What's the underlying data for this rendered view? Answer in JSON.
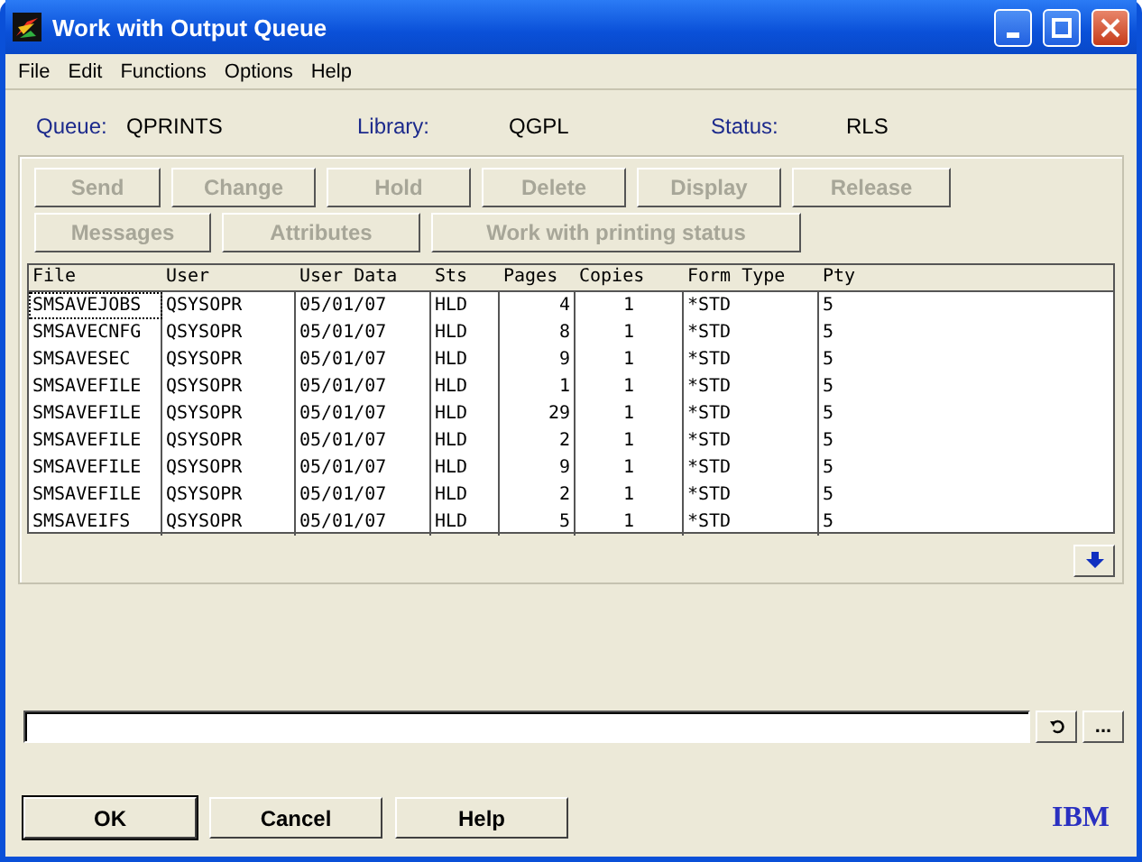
{
  "window": {
    "title": "Work with Output Queue"
  },
  "menu": [
    "File",
    "Edit",
    "Functions",
    "Options",
    "Help"
  ],
  "info": [
    {
      "label": "Queue:",
      "value": "QPRINTS"
    },
    {
      "label": "Library:",
      "value": "QGPL"
    },
    {
      "label": "Status:",
      "value": "RLS"
    }
  ],
  "action_rows": [
    [
      {
        "label": "Send",
        "disabled": true
      },
      {
        "label": "Change",
        "disabled": true
      },
      {
        "label": "Hold",
        "disabled": true
      },
      {
        "label": "Delete",
        "disabled": true
      },
      {
        "label": "Display",
        "disabled": true
      },
      {
        "label": "Release",
        "disabled": true
      }
    ],
    [
      {
        "label": "Messages",
        "disabled": true
      },
      {
        "label": "Attributes",
        "disabled": true
      },
      {
        "label": "Work with printing status",
        "disabled": true
      }
    ]
  ],
  "table": {
    "columns": [
      "File",
      "User",
      "User Data",
      "Sts",
      "Pages",
      "Copies",
      "Form Type",
      "Pty"
    ],
    "rows": [
      {
        "selected": true,
        "cells": [
          "SMSAVEJOBS",
          "QSYSOPR",
          "05/01/07",
          "HLD",
          "4",
          "1",
          "*STD",
          "5"
        ]
      },
      {
        "selected": false,
        "cells": [
          "SMSAVECNFG",
          "QSYSOPR",
          "05/01/07",
          "HLD",
          "8",
          "1",
          "*STD",
          "5"
        ]
      },
      {
        "selected": false,
        "cells": [
          "SMSAVESEC",
          "QSYSOPR",
          "05/01/07",
          "HLD",
          "9",
          "1",
          "*STD",
          "5"
        ]
      },
      {
        "selected": false,
        "cells": [
          "SMSAVEFILE",
          "QSYSOPR",
          "05/01/07",
          "HLD",
          "1",
          "1",
          "*STD",
          "5"
        ]
      },
      {
        "selected": false,
        "cells": [
          "SMSAVEFILE",
          "QSYSOPR",
          "05/01/07",
          "HLD",
          "29",
          "1",
          "*STD",
          "5"
        ]
      },
      {
        "selected": false,
        "cells": [
          "SMSAVEFILE",
          "QSYSOPR",
          "05/01/07",
          "HLD",
          "2",
          "1",
          "*STD",
          "5"
        ]
      },
      {
        "selected": false,
        "cells": [
          "SMSAVEFILE",
          "QSYSOPR",
          "05/01/07",
          "HLD",
          "9",
          "1",
          "*STD",
          "5"
        ]
      },
      {
        "selected": false,
        "cells": [
          "SMSAVEFILE",
          "QSYSOPR",
          "05/01/07",
          "HLD",
          "2",
          "1",
          "*STD",
          "5"
        ]
      },
      {
        "selected": false,
        "cells": [
          "SMSAVEIFS",
          "QSYSOPR",
          "05/01/07",
          "HLD",
          "5",
          "1",
          "*STD",
          "5"
        ]
      }
    ]
  },
  "command": {
    "browse_button": "..."
  },
  "buttons": [
    {
      "label": "OK",
      "default": true
    },
    {
      "label": "Cancel",
      "default": false
    },
    {
      "label": "Help",
      "default": false
    }
  ],
  "logo": "IBM"
}
